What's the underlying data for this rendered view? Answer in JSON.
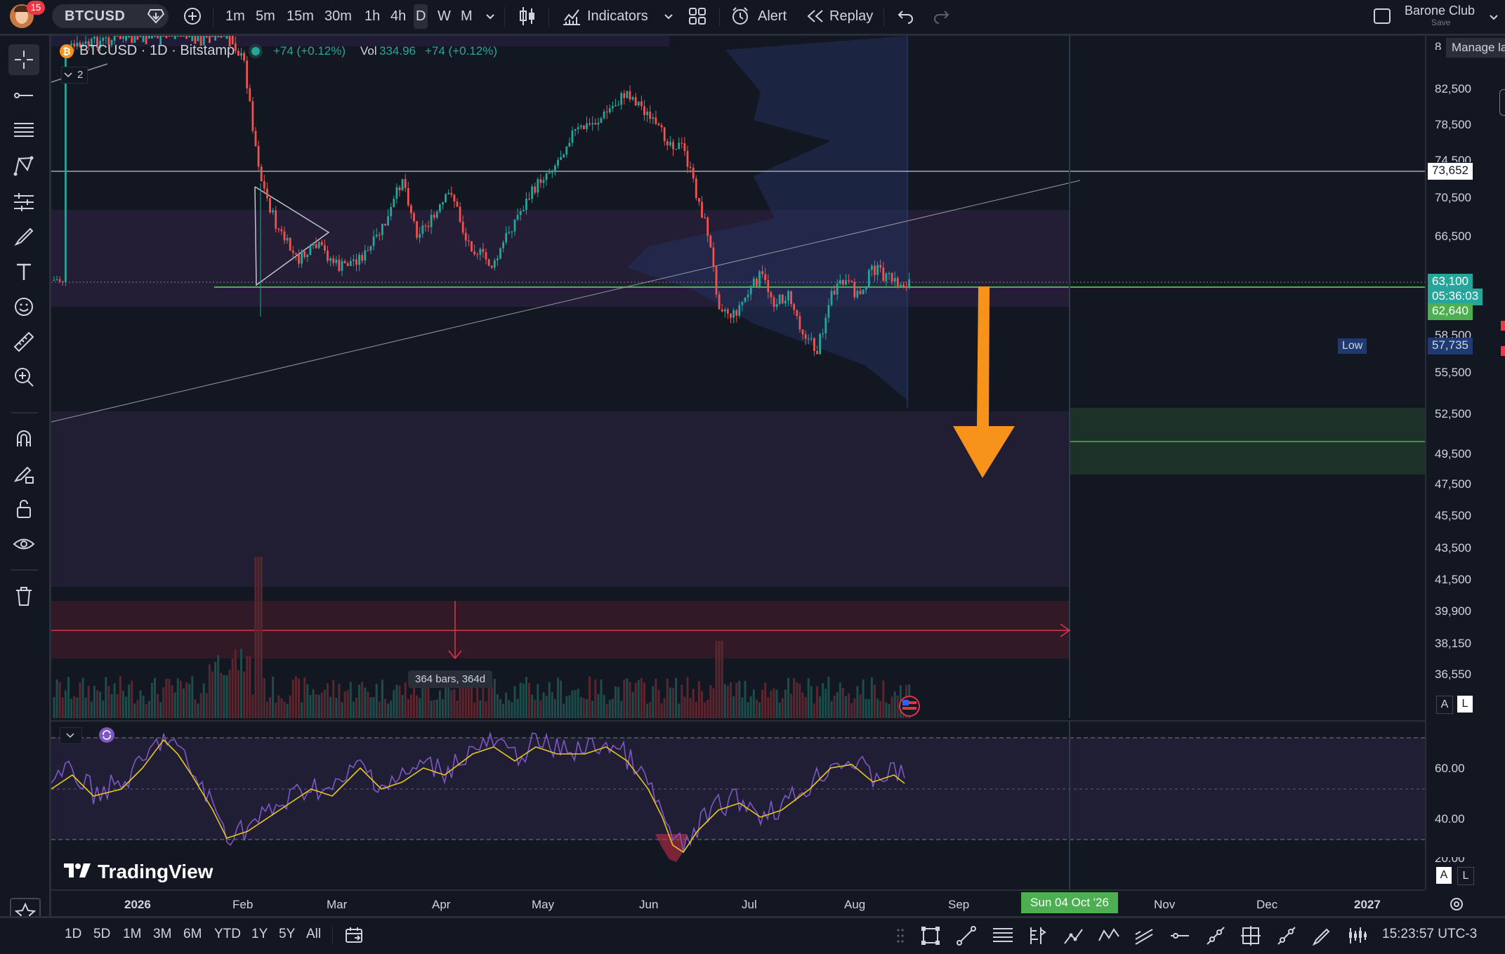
{
  "topbar": {
    "notification_count": "15",
    "symbol": "BTCUSD",
    "timeframes": [
      "1m",
      "5m",
      "15m",
      "30m",
      "1h",
      "4h",
      "D",
      "W",
      "M"
    ],
    "active_timeframe": "D",
    "indicators_label": "Indicators",
    "alert_label": "Alert",
    "replay_label": "Replay",
    "layout_name": "Barone Club",
    "layout_save": "Save",
    "manage_tooltip": "Manage la"
  },
  "legend": {
    "title": "BTCUSD · 1D · Bitstamp",
    "change": "+74 (+0.12%)",
    "vol_label": "Vol",
    "vol_value": "334.96",
    "vol_change": "+74 (+0.12%)",
    "collapse_count": "2"
  },
  "price_axis": {
    "ticks": [
      "8",
      "82,500",
      "78,500",
      "74,500",
      "70,500",
      "66,500",
      "58,500",
      "55,500",
      "52,500",
      "49,500",
      "47,500",
      "45,500",
      "43,500",
      "41,500",
      "39,900",
      "38,150",
      "36,550"
    ],
    "label_73652": "73,652",
    "label_last": "63,100",
    "label_countdown": "05:36:03",
    "label_62640": "62,640",
    "low_text": "Low",
    "low_value": "57,735",
    "auto_btn": "A",
    "log_btn": "L"
  },
  "measure_label": "364 bars, 364d",
  "rsi_axis": {
    "ticks": [
      "60.00",
      "40.00",
      "20.00"
    ],
    "auto_btn": "A",
    "log_btn": "L"
  },
  "watermark": "TradingView",
  "time_axis": {
    "ticks": [
      "2026",
      "Feb",
      "Mar",
      "Apr",
      "May",
      "Jun",
      "Jul",
      "Aug",
      "Sep",
      "Nov",
      "Dec",
      "2027"
    ],
    "cursor_label": "Sun 04 Oct '26"
  },
  "bottombar": {
    "ranges": [
      "1D",
      "5D",
      "1M",
      "3M",
      "6M",
      "YTD",
      "1Y",
      "5Y",
      "All"
    ],
    "clock": "15:23:57 UTC-3"
  },
  "colors": {
    "background": "#131722",
    "up": "#26a69a",
    "down": "#ef5350",
    "orange_arrow": "#f7931a",
    "green_line": "#4caf50",
    "rsi": "#7e57c2",
    "rsi_ma": "#e6c620"
  }
}
